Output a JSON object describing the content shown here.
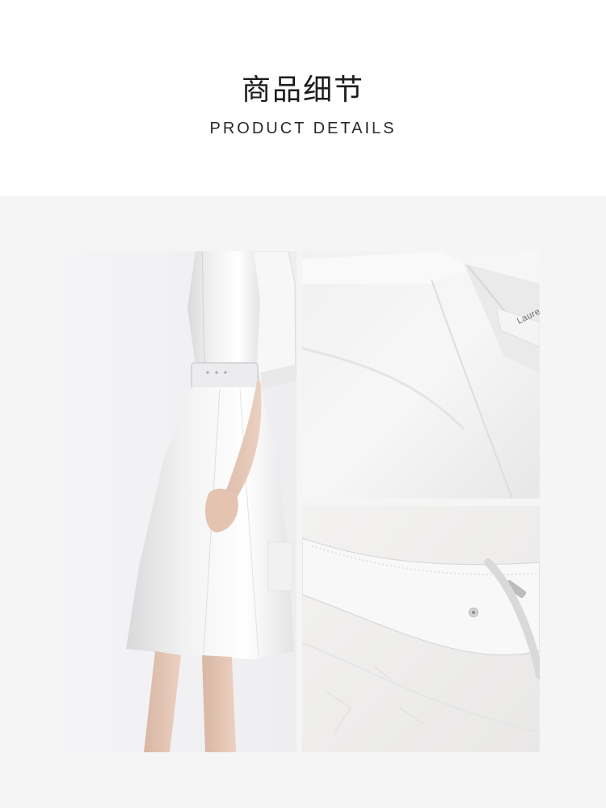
{
  "header": {
    "title_cn": "商品细节",
    "title_en": "PRODUCT DETAILS"
  },
  "gallery": {
    "background_color": "#f5f5f5",
    "photos": [
      {
        "id": "model",
        "subject": "white belted shirt dress worn by model"
      },
      {
        "id": "collar",
        "subject": "collar close-up",
        "label_text": "Laure"
      },
      {
        "id": "belt",
        "subject": "belt buckle close-up"
      }
    ]
  }
}
